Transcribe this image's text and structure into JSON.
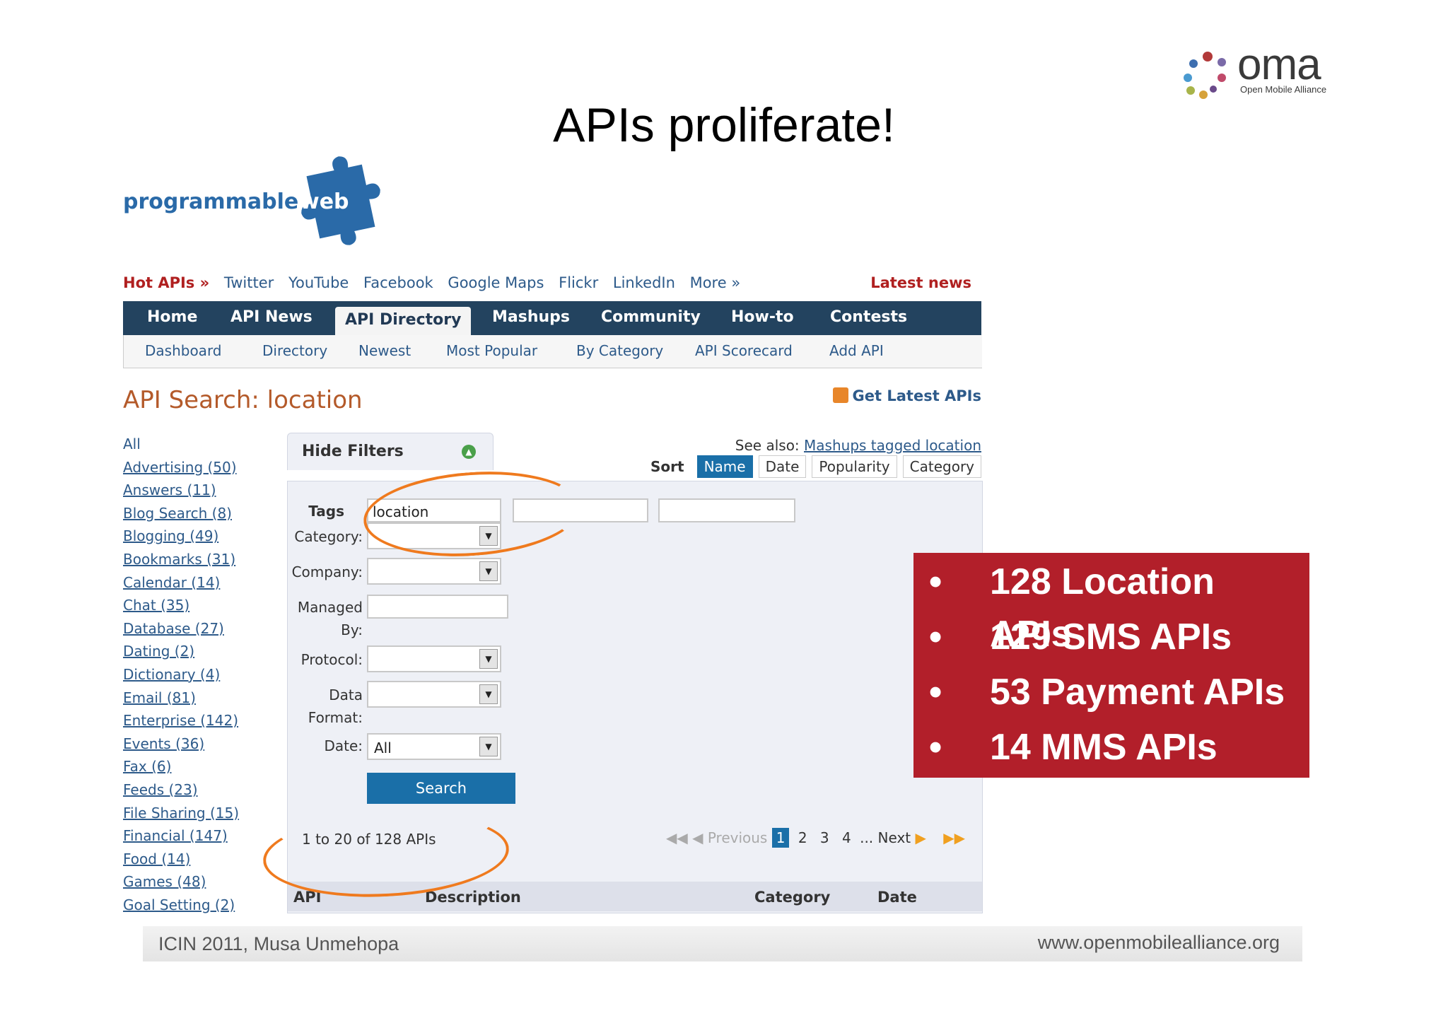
{
  "slide": {
    "title": "APIs proliferate!",
    "oma_logo": {
      "word": "oma",
      "subtitle": "Open Mobile Alliance"
    },
    "footer_left": "ICIN 2011, Musa Unmehopa",
    "footer_right": "www.openmobilealliance.org"
  },
  "pw_logo": {
    "part1": "programmable",
    "part2": "web"
  },
  "hot_apis": {
    "label": "Hot APIs »",
    "items": [
      "Twitter",
      "YouTube",
      "Facebook",
      "Google Maps",
      "Flickr",
      "LinkedIn",
      "More »"
    ],
    "latest_news": "Latest news"
  },
  "main_nav": [
    "Home",
    "API News",
    "API Directory",
    "Mashups",
    "Community",
    "How-to",
    "Contests"
  ],
  "main_nav_active": "API Directory",
  "sub_nav": [
    "Dashboard",
    "Directory",
    "Newest",
    "Most Popular",
    "By Category",
    "API Scorecard",
    "Add API"
  ],
  "search_heading": "API Search: location",
  "latest_apis": "Get Latest APIs",
  "categories": [
    "All",
    "Advertising (50)",
    "Answers (11)",
    "Blog Search (8)",
    "Blogging (49)",
    "Bookmarks (31)",
    "Calendar (14)",
    "Chat (35)",
    "Database (27)",
    "Dating (2)",
    "Dictionary (4)",
    "Email (81)",
    "Enterprise (142)",
    "Events (36)",
    "Fax (6)",
    "Feeds (23)",
    "File Sharing (15)",
    "Financial (147)",
    "Food (14)",
    "Games (48)",
    "Goal Setting (2)"
  ],
  "filters": {
    "hide_label": "Hide Filters",
    "see_also_prefix": "See also:",
    "see_also_link": "Mashups tagged location",
    "sort_label": "Sort",
    "sort_options": [
      "Name",
      "Date",
      "Popularity",
      "Category"
    ],
    "sort_active": "Name",
    "tags_label": "Tags",
    "tags_value": "location",
    "category_label": "Category:",
    "company_label": "Company:",
    "managed_label_1": "Managed",
    "managed_label_2": "By:",
    "protocol_label": "Protocol:",
    "data_label_1": "Data",
    "data_label_2": "Format:",
    "date_label": "Date:",
    "date_value": "All",
    "search_button": "Search"
  },
  "results": {
    "count_text": "1 to 20 of 128 APIs",
    "previous": "Previous",
    "pages": [
      "1",
      "2",
      "3",
      "4"
    ],
    "ellipsis": "...",
    "next": "Next",
    "current_page": "1",
    "columns": [
      "API",
      "Description",
      "Category",
      "Date"
    ]
  },
  "callout": {
    "bullets": [
      "128 Location APIs",
      "129 SMS APIs",
      "53 Payment APIs",
      "14 MMS APIs"
    ]
  },
  "colors": {
    "callout_bg": "#b21f2a",
    "nav_bg": "#23435f",
    "highlight_orange": "#ef7a1e",
    "link_blue": "#2d5a8a"
  }
}
